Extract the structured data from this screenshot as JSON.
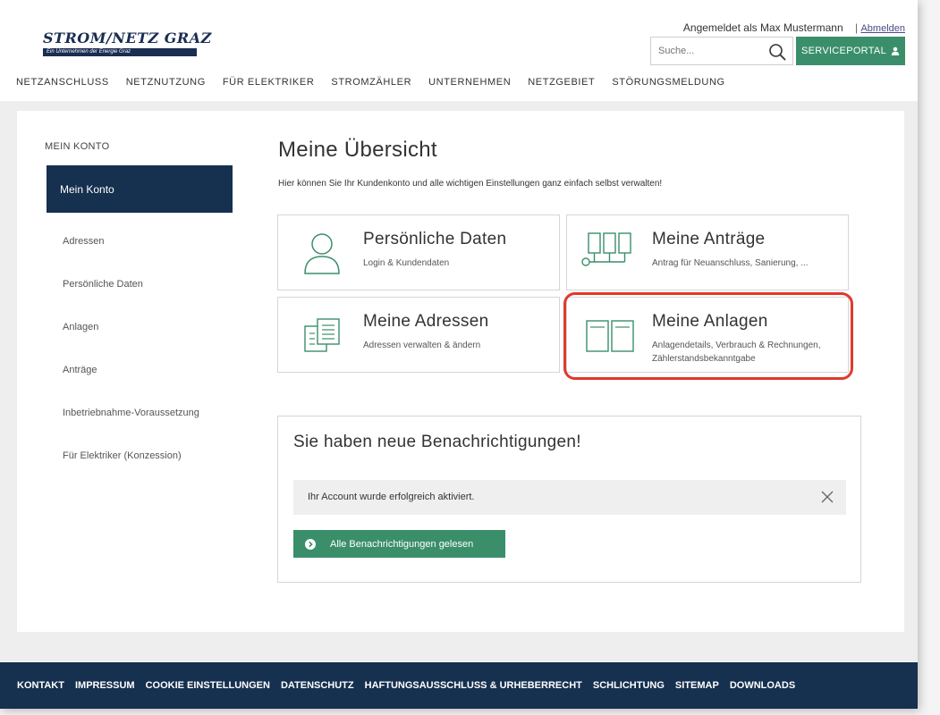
{
  "header": {
    "logo_main": "STROM/NETZ GRAZ",
    "logo_sub": "Ein Unternehmen der Energie Graz",
    "logged_in_text": "Angemeldet als Max Mustermann",
    "separator": "|",
    "logout_label": "Abmelden",
    "search_placeholder": "Suche...",
    "search_icon": "search-icon",
    "serviceportal_label": "SERVICEPORTAL",
    "serviceportal_icon": "user-icon"
  },
  "nav": {
    "items": [
      {
        "label": "NETZANSCHLUSS"
      },
      {
        "label": "NETZNUTZUNG"
      },
      {
        "label": "FÜR ELEKTRIKER"
      },
      {
        "label": "STROMZÄHLER"
      },
      {
        "label": "UNTERNEHMEN"
      },
      {
        "label": "NETZGEBIET"
      },
      {
        "label": "STÖRUNGSMELDUNG"
      }
    ]
  },
  "sidebar": {
    "title": "MEIN KONTO",
    "active": "Mein Konto",
    "items": [
      {
        "label": "Adressen"
      },
      {
        "label": "Persönliche Daten"
      },
      {
        "label": "Anlagen"
      },
      {
        "label": "Anträge"
      },
      {
        "label": "Inbetriebnahme-Voraussetzung"
      },
      {
        "label": "Für Elektriker (Konzession)"
      }
    ]
  },
  "main": {
    "title": "Meine Übersicht",
    "subtitle": "Hier können Sie Ihr Kundenkonto und alle wichtigen Einstellungen ganz einfach selbst verwalten!",
    "cards": [
      {
        "title": "Persönliche Daten",
        "desc": "Login & Kundendaten",
        "icon": "person-icon"
      },
      {
        "title": "Meine Anträge",
        "desc": "Antrag für Neuanschluss, Sanierung, ...",
        "icon": "flowchart-icon"
      },
      {
        "title": "Meine Adressen",
        "desc": "Adressen verwalten & ändern",
        "icon": "documents-icon"
      },
      {
        "title": "Meine Anlagen",
        "desc": "Anlagendetails, Verbrauch & Rechnungen, Zählerstandsbekanntgabe",
        "icon": "panels-icon"
      }
    ],
    "highlight_color": "#e0392c"
  },
  "notifications": {
    "title": "Sie haben neue Benachrichtigungen!",
    "message": "Ihr Account wurde erfolgreich aktiviert.",
    "close_icon": "close-icon",
    "mark_all_label": "Alle Benachrichtigungen gelesen",
    "mark_all_icon": "arrow-right-circle-icon"
  },
  "footer": {
    "links": [
      {
        "label": "KONTAKT"
      },
      {
        "label": "IMPRESSUM"
      },
      {
        "label": "COOKIE EINSTELLUNGEN"
      },
      {
        "label": "DATENSCHUTZ"
      },
      {
        "label": "HAFTUNGSAUSSCHLUSS & URHEBERRECHT"
      },
      {
        "label": "SCHLICHTUNG"
      },
      {
        "label": "SITEMAP"
      },
      {
        "label": "DOWNLOADS"
      }
    ]
  },
  "colors": {
    "navy": "#16304f",
    "green": "#3a8f6a",
    "icon_green": "#3a8f6a",
    "highlight_red": "#e0392c"
  }
}
